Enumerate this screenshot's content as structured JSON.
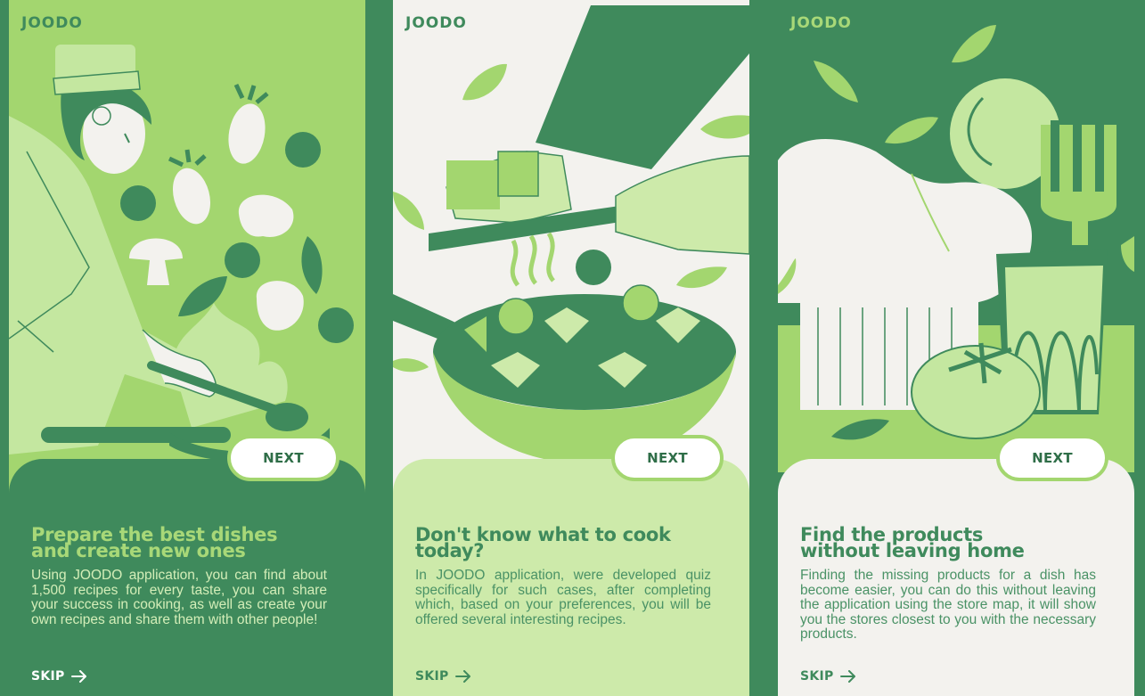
{
  "brand": {
    "logo": "JOODO"
  },
  "screens": [
    {
      "title_line1": "Prepare the best dishes",
      "title_line2": "and create new ones",
      "description": "Using JOODO application, you can find about 1,500 recipes for every taste, you can share your success in cooking, as well as create your own recipes and share them with other people!",
      "next_label": "NEXT",
      "skip_label": "SKIP",
      "illustration": "chef-cooking-with-pan"
    },
    {
      "title_line1": "Don't know what to cook",
      "title_line2": "today?",
      "description": "In JOODO application, were developed quiz specifically for such cases, after completing which, based on your preferences, you will be offered several interesting recipes.",
      "next_label": "NEXT",
      "skip_label": "SKIP",
      "illustration": "hands-adding-food-to-bowl"
    },
    {
      "title_line1": "Find the products",
      "title_line2": "without leaving home",
      "description": "Finding the missing products for a dish has become easier, you can do this without leaving the application using the store map, it will show you the stores closest to you with the necessary products.",
      "next_label": "NEXT",
      "skip_label": "SKIP",
      "illustration": "chef-hat-fork-glass-tomato"
    }
  ],
  "colors": {
    "dark_green": "#3f8a5c",
    "light_green": "#a3d66f",
    "pale_green": "#cdeaaa",
    "off_white": "#f3f2ee"
  }
}
